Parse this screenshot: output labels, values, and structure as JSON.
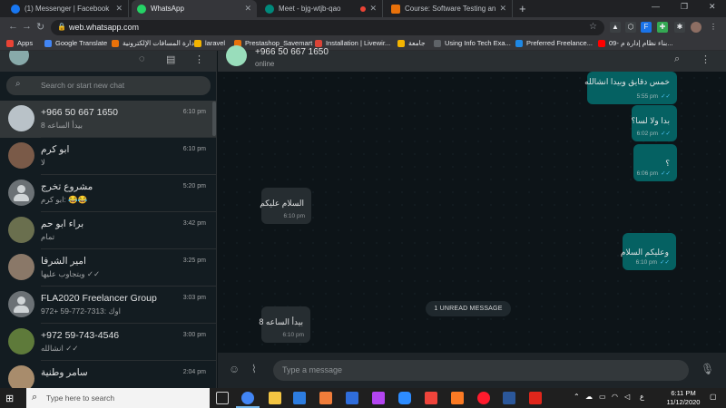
{
  "browser": {
    "tabs": [
      {
        "title": "(1) Messenger | Facebook",
        "color": "#1877f2",
        "icon": "messenger-icon"
      },
      {
        "title": "WhatsApp",
        "color": "#25d366",
        "icon": "whatsapp-icon",
        "active": true
      },
      {
        "title": "Meet - bjg-wtjb-qao",
        "color": "#00897b",
        "icon": "meet-icon"
      },
      {
        "title": "Course: Software Testing and Qu...",
        "color": "#e8710a",
        "icon": "course-icon"
      }
    ],
    "new_tab": "+",
    "url": "web.whatsapp.com",
    "bookmarks": [
      {
        "label": "Apps",
        "color": "#ea4335"
      },
      {
        "label": "Google Translate",
        "color": "#4285f4"
      },
      {
        "label": "إدارة المسافات الإلكترونية",
        "color": "#e8710a"
      },
      {
        "label": "laravel",
        "color": "#f4b400"
      },
      {
        "label": "Prestashop_Savemart",
        "color": "#e8710a"
      },
      {
        "label": "Installation | Livewir...",
        "color": "#db4437"
      },
      {
        "label": "جامعة",
        "color": "#f4b400"
      },
      {
        "label": "Using Info Tech Exa...",
        "color": "#5f6368"
      },
      {
        "label": "Preferred Freelance...",
        "color": "#1e88e5"
      },
      {
        "label": "09- بناء نظام إدارة م...",
        "color": "#ff0000"
      }
    ]
  },
  "sidebar": {
    "search_placeholder": "Search or start new chat",
    "chats": [
      {
        "name": "+966 50 667 1650",
        "last": "بيدأ الساعه 8",
        "time": "6:10 pm",
        "avatar": "#b9c2c8",
        "group": false,
        "selected": true
      },
      {
        "name": "ابو كرم",
        "last": "لا",
        "time": "6:10 pm",
        "avatar": "#7a5a48",
        "group": false
      },
      {
        "name": "مشروع تخرج",
        "last": "ابو كرم: 😂😂",
        "time": "5:20 pm",
        "avatar": "",
        "group": true
      },
      {
        "name": "براء ابو حم",
        "last": "تمام",
        "time": "3:42 pm",
        "avatar": "#6a6f4e",
        "group": false
      },
      {
        "name": "امير الشرفا",
        "last": "وبتجاوب عليها ✓✓",
        "time": "3:25 pm",
        "avatar": "#8a7868",
        "group": false
      },
      {
        "name": "FLA2020 Freelancer Group",
        "last": "اوك :7313-772-59 +972",
        "time": "3:03 pm",
        "avatar": "",
        "group": true
      },
      {
        "name": "+972 59-743-4546",
        "last": "انشالله ✓✓",
        "time": "3:00 pm",
        "avatar": "#5e7a3a",
        "group": false
      },
      {
        "name": "سامر وطنية",
        "last": "",
        "time": "2:04 pm",
        "avatar": "#a88c6c",
        "group": false
      }
    ]
  },
  "conversation": {
    "contact_name": "+966 50 667 1650",
    "status": "online",
    "unread_label": "1 UNREAD MESSAGE",
    "messages": [
      {
        "text": "خمس دقايق وبيدا انشالله",
        "time": "5:55 pm",
        "dir": "out",
        "ticks": "✓✓"
      },
      {
        "text": "بدا ولا لسا؟",
        "time": "6:02 pm",
        "dir": "out",
        "ticks": "✓✓"
      },
      {
        "text": "؟",
        "time": "6:06 pm",
        "dir": "out",
        "ticks": "✓✓"
      },
      {
        "text": "السلام عليكم",
        "time": "6:10 pm",
        "dir": "in",
        "ticks": ""
      },
      {
        "text": "وعليكم السلام",
        "time": "6:10 pm",
        "dir": "out",
        "ticks": "✓✓"
      },
      {
        "text": "بيدأ الساعه 8",
        "time": "6:10 pm",
        "dir": "in",
        "ticks": ""
      }
    ],
    "composer_placeholder": "Type a message"
  },
  "taskbar": {
    "search_placeholder": "Type here to search",
    "time": "6:11 PM",
    "date": "11/12/2020",
    "language": "ع",
    "apps": [
      {
        "name": "task-view",
        "color": "#cfcfcf"
      },
      {
        "name": "chrome",
        "color": "#4285f4",
        "active": true
      },
      {
        "name": "file-explorer",
        "color": "#f4c542"
      },
      {
        "name": "microsoft-store",
        "color": "#2d7de0"
      },
      {
        "name": "mail",
        "color": "#f07d3a"
      },
      {
        "name": "photos",
        "color": "#2f6ddb"
      },
      {
        "name": "phpstorm",
        "color": "#b345f1"
      },
      {
        "name": "zoom",
        "color": "#2d8cff"
      },
      {
        "name": "anydesk",
        "color": "#ef443b"
      },
      {
        "name": "xampp",
        "color": "#fb7a24"
      },
      {
        "name": "opera",
        "color": "#ff1b2d"
      },
      {
        "name": "word",
        "color": "#2b579a"
      },
      {
        "name": "acrobat",
        "color": "#e0261b"
      }
    ]
  }
}
